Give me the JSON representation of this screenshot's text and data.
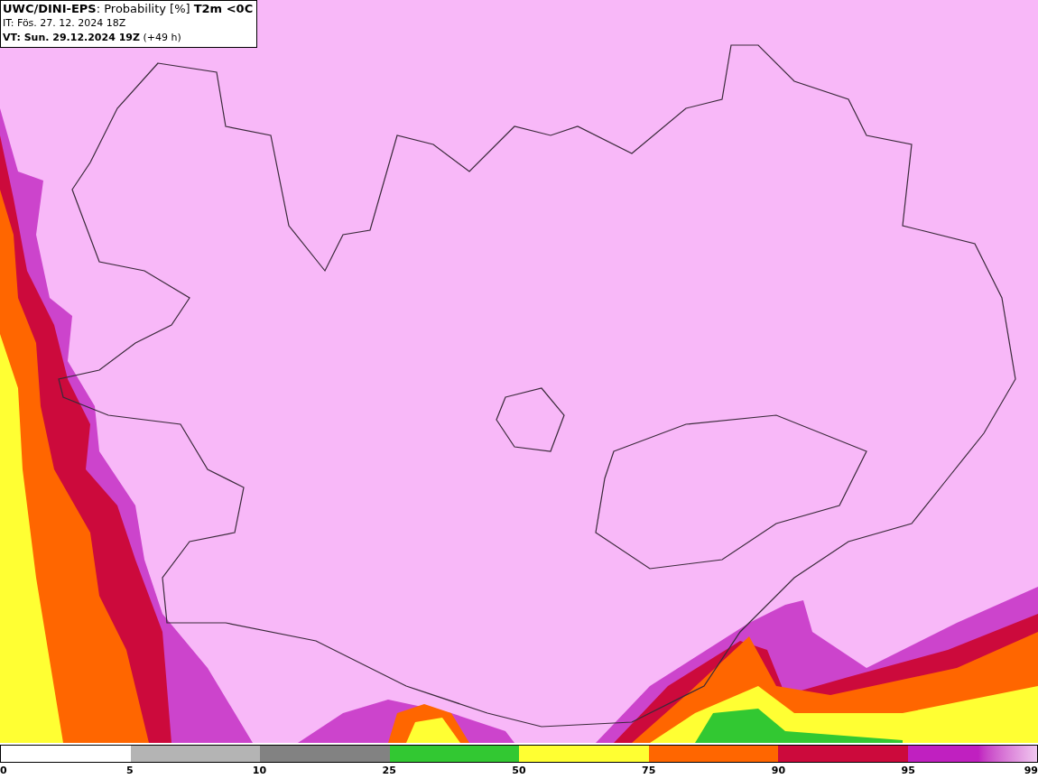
{
  "header": {
    "title": "**UWC/DINI-EPS**: Probability [%] **T2m <0C**",
    "init_time": "IT: Fös. 27. 12. 2024 18Z",
    "valid_time": "**VT: Sun. 29.12.2024 19Z** (+49 h)"
  },
  "legend": {
    "bins": [
      {
        "kind": "solid",
        "color": "#b4b4b4"
      },
      {
        "kind": "solid",
        "color": "#828282"
      },
      {
        "kind": "solid",
        "color": "#32c832"
      },
      {
        "kind": "solid",
        "color": "#ffff32"
      },
      {
        "kind": "solid",
        "color": "#ff6600"
      },
      {
        "kind": "solid",
        "color": "#cc0a3c"
      },
      {
        "kind": "gradient",
        "color": "#c020c0"
      }
    ],
    "labels": [
      "0",
      "5",
      "10",
      "25",
      "50",
      "75",
      "90",
      "95",
      "99"
    ]
  }
}
